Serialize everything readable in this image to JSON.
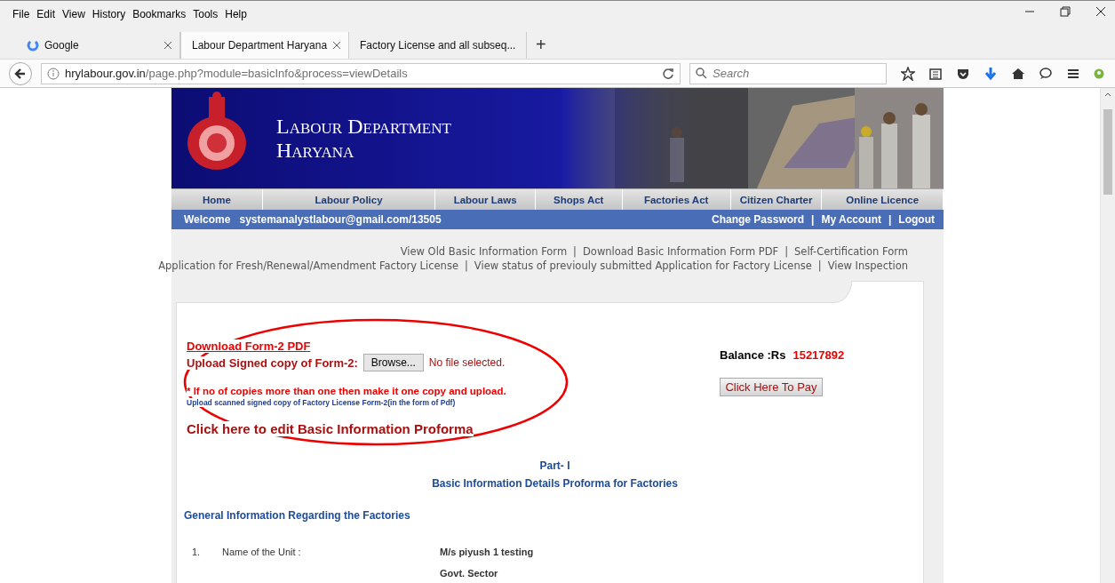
{
  "menu": [
    "File",
    "Edit",
    "View",
    "History",
    "Bookmarks",
    "Tools",
    "Help"
  ],
  "tabs": [
    {
      "label": "Google",
      "selected": false,
      "kind": "google"
    },
    {
      "label": "Labour Department Haryana",
      "selected": true,
      "kind": "plain"
    },
    {
      "label": "Factory License and all subseq...",
      "selected": false,
      "kind": "plain"
    }
  ],
  "new_tab": "+",
  "address": {
    "host": "hrylabour.gov.in",
    "path": "/page.php?module=basicInfo&process=viewDetails"
  },
  "search": {
    "placeholder": "Search"
  },
  "site": {
    "title_line_1": "Labour Department",
    "title_line_2": "Haryana",
    "nav": [
      "Home",
      "Labour Policy",
      "Labour Laws",
      "Shops Act",
      "Factories Act",
      "Citizen Charter",
      "Online Licence"
    ],
    "welcome": {
      "label": "Welcome",
      "user": "systemanalystlabour@gmail.com/13505",
      "links": [
        {
          "kind": "link",
          "text": "Change Password"
        },
        {
          "kind": "separator",
          "text": "|"
        },
        {
          "kind": "link",
          "text": "My Account"
        },
        {
          "kind": "separator",
          "text": "|"
        },
        {
          "kind": "link",
          "text": "Logout"
        }
      ]
    }
  },
  "quick_links": [
    [
      {
        "kind": "link",
        "text": "View Old Basic Information Form"
      },
      {
        "kind": "separator",
        "text": "|"
      },
      {
        "kind": "link",
        "text": "Download Basic Information Form PDF"
      },
      {
        "kind": "separator",
        "text": "|"
      },
      {
        "kind": "link",
        "text": "Self-Certification Form"
      }
    ],
    [
      {
        "kind": "link",
        "text": "Application for Fresh/Renewal/Amendment Factory License"
      },
      {
        "kind": "separator",
        "text": "|"
      },
      {
        "kind": "link",
        "text": "View status of previouly submitted Application for Factory License"
      },
      {
        "kind": "separator",
        "text": "|"
      },
      {
        "kind": "link",
        "text": "View Inspection"
      }
    ]
  ],
  "form": {
    "download_link": "Download Form-2 PDF",
    "upload_label": "Upload Signed copy of Form-2:",
    "browse_button": "Browse...",
    "file_status": "No file selected.",
    "note": "* If no of copies more than one then make it one copy and upload.",
    "hint": "Upload scanned signed copy of Factory License Form-2(in the form of Pdf)",
    "balance_label": "Balance :Rs",
    "balance_value": "15217892",
    "pay_button": "Click Here To Pay",
    "edit_link": "Click here to edit Basic Information Proforma"
  },
  "proforma": {
    "part": "Part- I",
    "title": "Basic Information Details Proforma for Factories",
    "section": "General Information Regarding the Factories",
    "rows": [
      {
        "number": "1.",
        "label": "Name of the Unit :",
        "value": "M/s piyush 1 testing"
      },
      {
        "value": "Govt. Sector"
      }
    ]
  }
}
